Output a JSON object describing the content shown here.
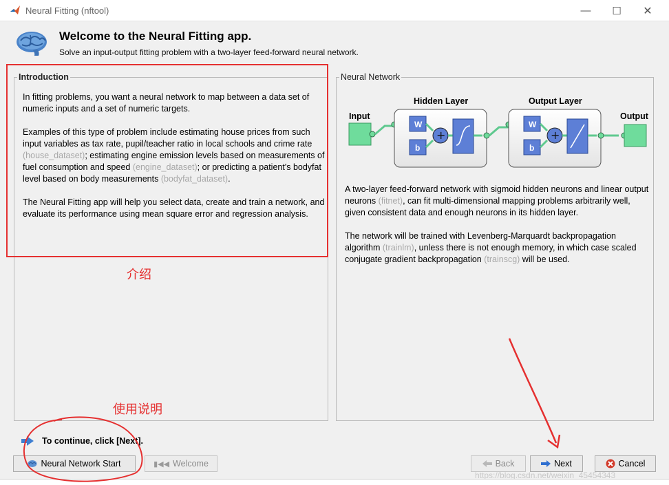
{
  "window": {
    "title": "Neural Fitting (nftool)"
  },
  "header": {
    "title": "Welcome to the Neural Fitting app.",
    "subtitle": "Solve an input-output fitting problem with a two-layer feed-forward neural network."
  },
  "intro": {
    "legend": "Introduction",
    "p1": "In fitting problems, you want a neural network to map between a data set of numeric inputs and a set of numeric targets.",
    "p2_a": "Examples of this type of problem include estimating house prices from such input variables as tax rate, pupil/teacher ratio in local schools and crime rate ",
    "p2_ref1": "(house_dataset)",
    "p2_b": "; estimating engine emission levels based on measurements of fuel consumption and speed ",
    "p2_ref2": "(engine_dataset)",
    "p2_c": "; or predicting a patient's bodyfat level based on body measurements ",
    "p2_ref3": "(bodyfat_dataset)",
    "p2_d": ".",
    "p3": "The Neural Fitting app will help you select data, create and train a network, and evaluate its performance using mean square error and regression analysis."
  },
  "network": {
    "legend": "Neural Network",
    "input_label": "Input",
    "hidden_label": "Hidden Layer",
    "output_layer_label": "Output Layer",
    "output_label": "Output",
    "w_label": "W",
    "b_label": "b",
    "p1_a": "A two-layer feed-forward network with sigmoid hidden neurons and linear output neurons ",
    "p1_ref": "(fitnet)",
    "p1_b": ", can fit multi-dimensional mapping problems arbitrarily well, given consistent data and enough neurons in its hidden layer.",
    "p2_a": "The network will be trained with Levenberg-Marquardt backpropagation algorithm ",
    "p2_ref1": "(trainlm)",
    "p2_b": ", unless there is not enough memory, in which case scaled conjugate gradient backpropagation ",
    "p2_ref2": "(trainscg)",
    "p2_c": " will be used."
  },
  "annotations": {
    "intro_note": "介绍",
    "usage_note": "使用说明"
  },
  "footer": {
    "continue_text": "To continue, click [Next].",
    "start_label": "Neural Network Start",
    "welcome_label": "Welcome",
    "back_label": "Back",
    "next_label": "Next",
    "cancel_label": "Cancel",
    "watermark": "https://blog.csdn.net/weixin_45454343"
  },
  "colors": {
    "annotation_red": "#e53030",
    "node_green": "#6fdc9c",
    "box_blue": "#5d7fd6"
  }
}
